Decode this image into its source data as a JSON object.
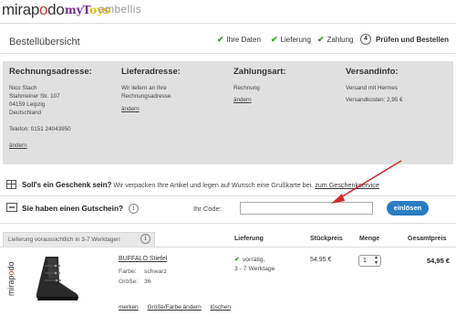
{
  "header": {
    "logos": {
      "mirapodo_prefix": "mirap",
      "mirapodo_accent": "o",
      "mirapodo_suffix": "do",
      "mytoys_a": "myT",
      "mytoys_b": "oys",
      "ambellis": "ambellis"
    }
  },
  "page_title": "Bestellübersicht",
  "steps": [
    {
      "label": "Ihre Daten",
      "done": true
    },
    {
      "label": "Lieferung",
      "done": true
    },
    {
      "label": "Zahlung",
      "done": true
    },
    {
      "number": "4",
      "label": "Prüfen und Bestellen",
      "current": true
    }
  ],
  "addresses": {
    "billing": {
      "heading": "Rechnungsadresse:",
      "lines": [
        "Nico Stach",
        "Stahmeiner Str. 107",
        "04159 Leipzig",
        "Deutschland",
        "",
        "Telefon: 0151 24043950"
      ],
      "edit_link": "ändern"
    },
    "delivery": {
      "heading": "Lieferadresse:",
      "lines": [
        "Wir liefern an Ihre",
        "Rechnungsadresse."
      ],
      "edit_link": "ändern"
    },
    "payment": {
      "heading": "Zahlungsart:",
      "lines": [
        "Rechnung"
      ],
      "edit_link": "ändern"
    },
    "shipping": {
      "heading": "Versandinfo:",
      "lines": [
        "Versand mit Hermes",
        "Versandkosten: 2,95 €"
      ]
    }
  },
  "gift": {
    "question": "Soll's ein Geschenk sein?",
    "text": " Wir verpacken Ihre Artikel und legen auf Wunsch eine Grußkarte bei. ",
    "link": "zum Geschenkservice"
  },
  "voucher": {
    "label": "Sie haben einen Gutschein?",
    "info": "i",
    "code_label": "Ihr Code:",
    "code_value": "",
    "code_placeholder": "",
    "button": "einlösen"
  },
  "cart": {
    "delivery_note": "Lieferung voraussichtlich in 3-7 Werktagen",
    "info": "i",
    "columns": {
      "delivery": "Lieferung",
      "unit_price": "Stückpreis",
      "quantity": "Menge",
      "total": "Gesamtpreis"
    },
    "brand_prefix": "mirap",
    "brand_accent": "o",
    "brand_suffix": "do",
    "item": {
      "name": "BUFFALO Stiefel",
      "color_label": "Farbe:",
      "color_value": "schwarz",
      "size_label": "Größe:",
      "size_value": "36",
      "availability_line1": "vorrätig,",
      "availability_line2": "3 - 7 Werktage",
      "unit_price": "54,95 €",
      "quantity": "1",
      "total": "54,95 €",
      "actions": [
        "merken",
        "Größe/Farbe ändern",
        "löschen"
      ]
    }
  },
  "colors": {
    "accent_blue": "#2b7cc1",
    "check_green": "#3a9a2a",
    "annotation_red": "#d22b2b",
    "address_bg": "#e0e0e0"
  }
}
